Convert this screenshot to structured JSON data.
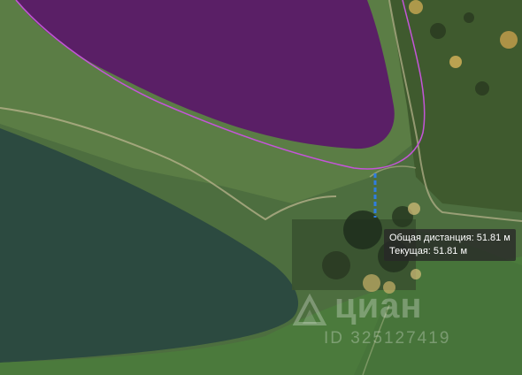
{
  "measurement": {
    "total_label": "Общая дистанция: 51.81 м",
    "current_label": "Текущая: 51.81 м",
    "line_color": "#2f7de1"
  },
  "watermark": {
    "brand": "циан",
    "listing_id": "ID 325127419"
  },
  "colors": {
    "plot_fill": "#5a1f66",
    "plot_outline": "#c455d8",
    "field_dark": "#2b4b3f",
    "field_light": "#4a7a3e"
  }
}
